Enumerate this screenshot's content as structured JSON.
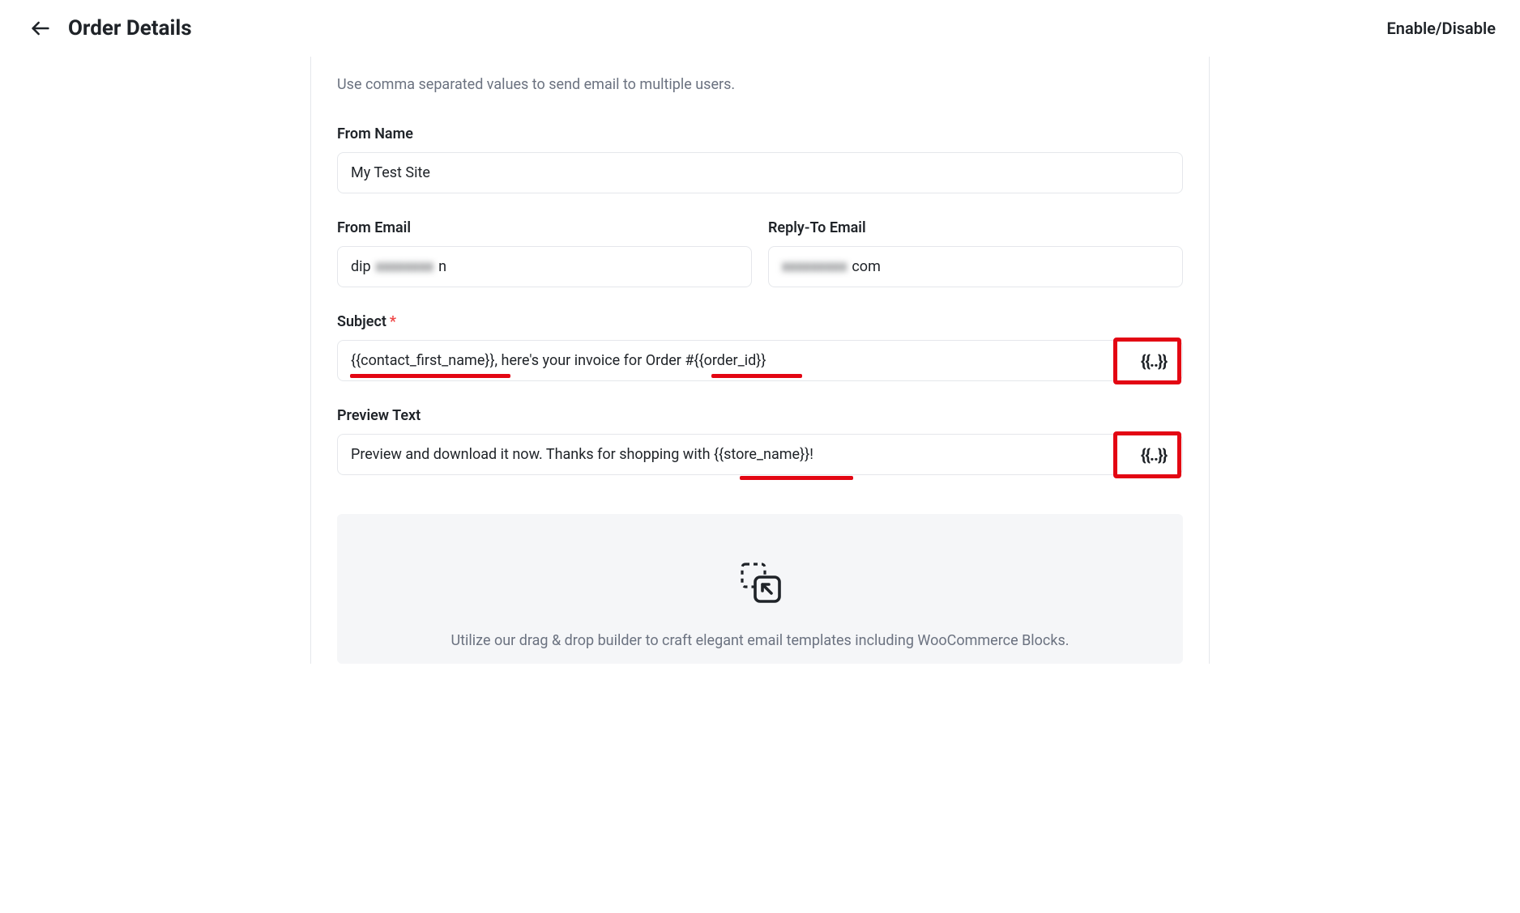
{
  "header": {
    "title": "Order Details",
    "toggle_label": "Enable/Disable"
  },
  "hint": "Use comma separated values to send email to multiple users.",
  "fields": {
    "from_name": {
      "label": "From Name",
      "value": "My Test Site"
    },
    "from_email": {
      "label": "From Email",
      "value_prefix": "dip",
      "value_mid_masked": "xxxxxxxx",
      "value_suffix": "n"
    },
    "reply_to": {
      "label": "Reply-To Email",
      "value_mid_masked": "xxxxxxxxx",
      "value_suffix": "com"
    },
    "subject": {
      "label": "Subject",
      "value": "{{contact_first_name}}, here's your invoice for Order #{{order_id}}",
      "merge_tag_button": "{{..}}"
    },
    "preview_text": {
      "label": "Preview Text",
      "value": "Preview and download it now. Thanks for shopping with {{store_name}}!",
      "merge_tag_button": "{{..}}"
    }
  },
  "builder": {
    "text": "Utilize our drag & drop builder to craft elegant email templates including WooCommerce Blocks."
  }
}
